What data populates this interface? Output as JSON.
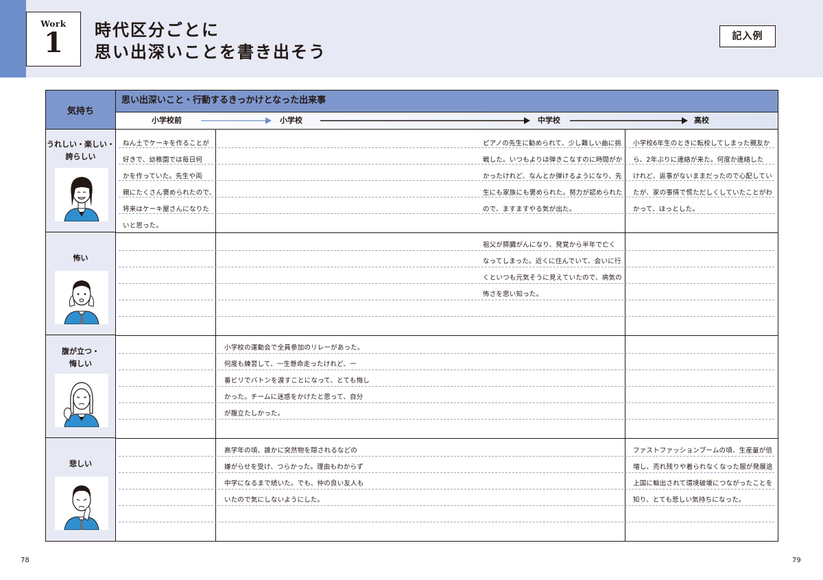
{
  "header": {
    "work_label": "Work",
    "work_number": "1",
    "title_line1": "時代区分ごとに",
    "title_line2": "思い出深いことを書き出そう",
    "badge": "記入例"
  },
  "table": {
    "feeling_header": "気持ち",
    "events_header": "思い出深いこと・行動するきっかけとなった出来事",
    "periods": [
      "小学校前",
      "小学校",
      "中学校",
      "高校"
    ],
    "rows": [
      {
        "feeling": [
          "うれしい・楽しい・",
          "誇らしい"
        ],
        "portrait_icon": "happy-student-icon",
        "cells": {
          "preschool": [
            "ねん土でケーキを作ることが",
            "好きで、幼稚園では毎日何",
            "かを作っていた。先生や両",
            "親にたくさん褒められたので、",
            "将来はケーキ屋さんになりた",
            "いと思った。"
          ],
          "elementary": [],
          "middle": [
            "ピアノの先生に勧められて、少し難しい曲に挑",
            "戦した。いつもよりは弾きこなすのに時間がか",
            "かったけれど、なんとか弾けるようになり、先",
            "生にも家族にも褒められた。努力が認められた",
            "ので、ますますやる気が出た。"
          ],
          "high": [
            "小学校6年生のときに転校してしまった親友か",
            "ら、2年ぶりに連絡が来た。何度か連絡した",
            "けれど、返事がないままだったので心配してい",
            "たが、家の事情で慌ただしくしていたことがわ",
            "かって、ほっとした。"
          ]
        }
      },
      {
        "feeling": [
          "怖い"
        ],
        "portrait_icon": "scared-student-icon",
        "cells": {
          "preschool": [],
          "elementary": [],
          "middle": [
            "祖父が膵臓がんになり、発覚から半年で亡く",
            "なってしまった。近くに住んでいて、会いに行",
            "くといつも元気そうに見えていたので、病気の",
            "怖さを思い知った。"
          ],
          "high": []
        }
      },
      {
        "feeling": [
          "腹が立つ・",
          "悔しい"
        ],
        "portrait_icon": "frustrated-student-icon",
        "cells": {
          "preschool": [],
          "elementary": [
            "小学校の運動会で全員参加のリレーがあった。",
            "何度も練習して、一生懸命走ったけれど、一",
            "番ビリでバトンを渡すことになって、とても悔し",
            "かった。チームに迷惑をかけたと思って、自分",
            "が腹立たしかった。"
          ],
          "middle": [],
          "high": []
        }
      },
      {
        "feeling": [
          "悲しい"
        ],
        "portrait_icon": "sad-student-icon",
        "cells": {
          "preschool": [],
          "elementary": [
            "高学年の頃、誰かに突然物を隠されるなどの",
            "嫌がらせを受け、つらかった。理由もわからず",
            "中学になるまで続いた。でも、仲の良い友人も",
            "いたので気にしないようにした。"
          ],
          "middle": [],
          "high": [
            "ファストファッションブームの頃、生産量が倍",
            "増し、売れ残りや着られなくなった服が発展途",
            "上国に輸出されて環境破壊につながったことを",
            "知り、とても悲しい気持ちになった。"
          ]
        }
      }
    ]
  },
  "page_numbers": {
    "left": "78",
    "right": "79"
  },
  "colors": {
    "accent": "#6d8fcb",
    "header_fill": "#7d97cd",
    "band": "#e7eaf5",
    "shirt": "#2f8fd0"
  }
}
